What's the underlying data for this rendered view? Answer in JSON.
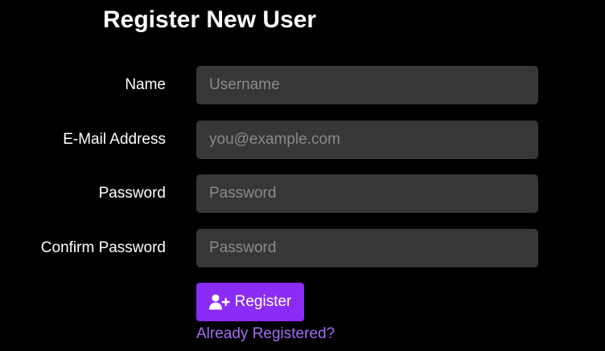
{
  "page": {
    "title": "Register New User"
  },
  "form": {
    "name": {
      "label": "Name",
      "placeholder": "Username",
      "value": ""
    },
    "email": {
      "label": "E-Mail Address",
      "placeholder": "you@example.com",
      "value": ""
    },
    "password": {
      "label": "Password",
      "placeholder": "Password",
      "value": ""
    },
    "confirm_password": {
      "label": "Confirm Password",
      "placeholder": "Password",
      "value": ""
    },
    "register_button": {
      "label": "Register",
      "icon": "user-plus-icon"
    },
    "login_link": {
      "label": "Already Registered?"
    }
  },
  "colors": {
    "background": "#000000",
    "input_background": "#373737",
    "accent": "#8a2cf5",
    "link": "#a56cf7"
  }
}
